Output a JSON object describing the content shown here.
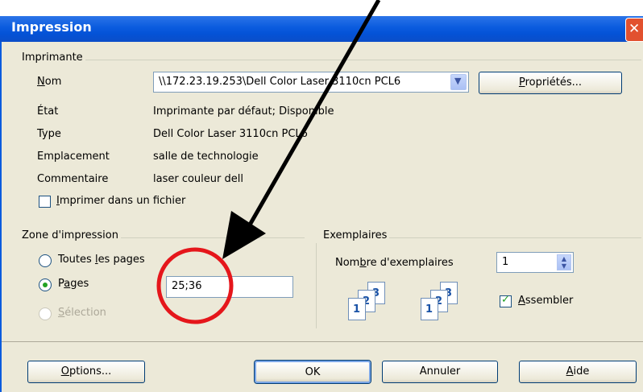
{
  "dialog": {
    "title": "Impression"
  },
  "printer": {
    "group_label": "Imprimante",
    "name_label": "Nom",
    "name_value": "\\\\172.23.19.253\\Dell Color Laser 3110cn PCL6",
    "properties_button": "Propriétés...",
    "state_label": "État",
    "state_value": "Imprimante par défaut; Disponible",
    "type_label": "Type",
    "type_value": "Dell Color Laser 3110cn PCL6",
    "location_label": "Emplacement",
    "location_value": "salle de technologie",
    "comment_label": "Commentaire",
    "comment_value": "laser couleur dell",
    "print_to_file_label": "Imprimer dans un fichier",
    "print_to_file_checked": false
  },
  "print_range": {
    "group_label": "Zone d'impression",
    "all_pages_label": "Toutes les pages",
    "pages_label": "Pages",
    "pages_value": "25;36",
    "selection_label": "Sélection",
    "selected": "Pages"
  },
  "copies": {
    "group_label": "Exemplaires",
    "count_label": "Nombre d'exemplaires",
    "count_value": "1",
    "collate_label": "Assembler",
    "collate_checked": true,
    "page_numbers": [
      "1",
      "2",
      "3"
    ]
  },
  "buttons": {
    "options": "Options...",
    "ok": "OK",
    "cancel": "Annuler",
    "help": "Aide"
  },
  "annotation": {
    "circle_color": "#e5161b",
    "arrow_color": "#000000"
  }
}
